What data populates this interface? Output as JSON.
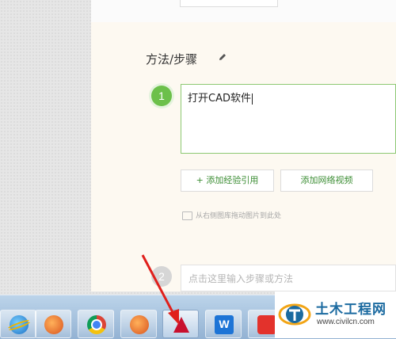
{
  "section": {
    "title": "方法/步骤",
    "edit_icon": "pencil-icon"
  },
  "steps": [
    {
      "number": "1",
      "text": "打开CAD软件"
    },
    {
      "number": "2",
      "placeholder": "点击这里输入步骤或方法"
    }
  ],
  "buttons": {
    "add_experience": "+ 添加经验引用",
    "add_video": "添加网络视频"
  },
  "drag_hint": "从右侧图库拖动图片到此处",
  "taskbar": {
    "apps": [
      {
        "name": "ie-icon",
        "active": false
      },
      {
        "name": "thunderbird-icon",
        "active": false
      },
      {
        "name": "chrome-icon",
        "active": false
      },
      {
        "name": "thunderbird-icon",
        "active": false
      },
      {
        "name": "autocad-icon",
        "active": true
      },
      {
        "name": "wps-icon",
        "active": false
      },
      {
        "name": "red-app-icon",
        "active": false
      }
    ]
  },
  "watermark": {
    "title": "土木工程网",
    "url": "www.civilcn.com"
  },
  "colors": {
    "step_active": "#6cc04a",
    "step_inactive": "#d6d6d6",
    "link_green": "#3b8d33",
    "arrow_red": "#e0201c",
    "watermark_blue": "#1b6aa0"
  }
}
